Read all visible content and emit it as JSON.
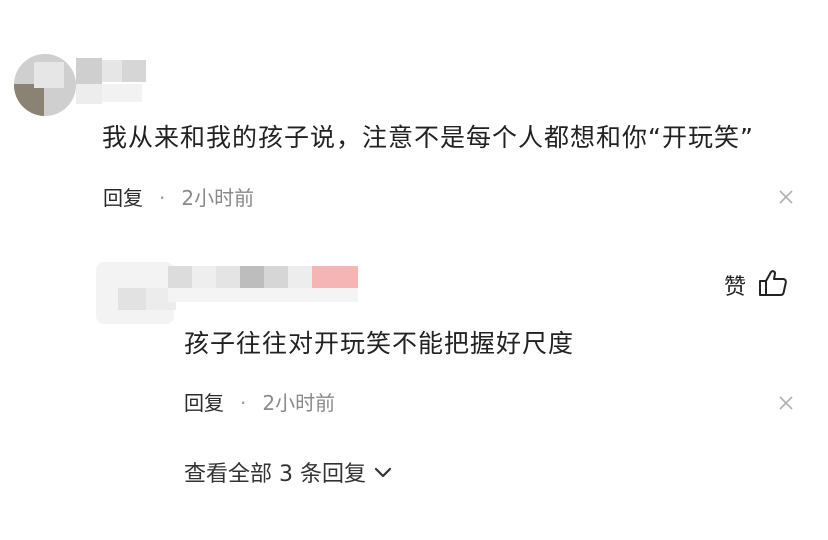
{
  "comment": {
    "text": "我从来和我的孩子说，注意不是每个人都想和你“开玩笑”",
    "reply_label": "回复",
    "separator": "·",
    "time": "2小时前"
  },
  "reply": {
    "text": "孩子往往对开玩笑不能把握好尺度",
    "reply_label": "回复",
    "separator": "·",
    "time": "2小时前",
    "like_label": "赞"
  },
  "more_replies": {
    "label": "查看全部 3 条回复"
  },
  "icons": {
    "close": "close-icon",
    "thumbs_up": "thumbs-up-icon",
    "chevron_down": "chevron-down-icon"
  },
  "colors": {
    "text": "#222222",
    "meta_gray": "#8a8a8a",
    "icon_gray": "#b0b0b0",
    "username_pink": "#f5b5b5"
  }
}
